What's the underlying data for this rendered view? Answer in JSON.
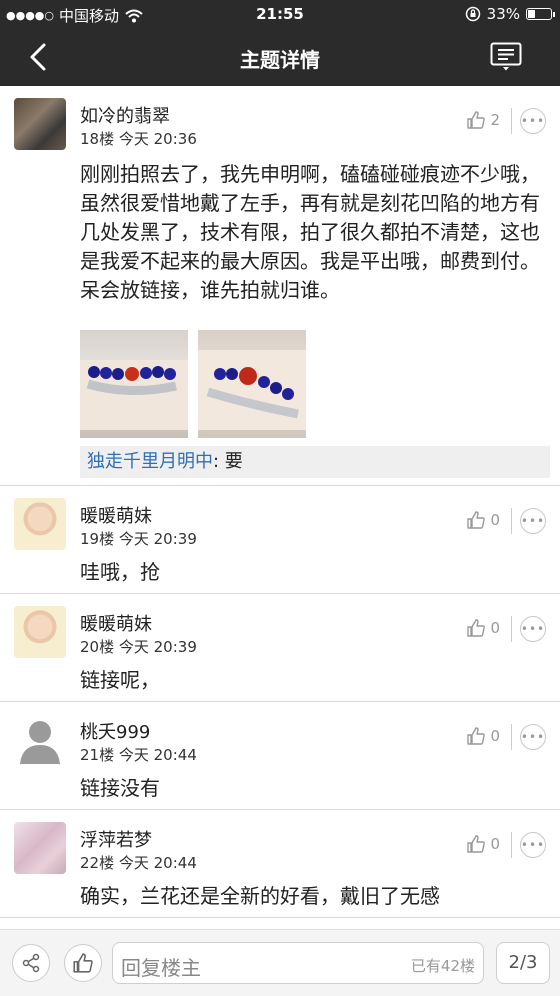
{
  "status_bar": {
    "carrier": "中国移动",
    "time": "21:55",
    "battery": "33%",
    "battery_level": 0.33
  },
  "nav": {
    "title": "主题详情"
  },
  "posts": [
    {
      "author": "如冷的翡翠",
      "floor": "18楼",
      "time": "今天 20:36",
      "likes": "2",
      "content": "刚刚拍照去了，我先申明啊，磕磕碰碰痕迹不少哦，虽然很爱惜地戴了左手，再有就是刻花凹陷的地方有几处发黑了，技术有限，拍了很久都拍不清楚，这也是我爱不起来的最大原因。我是平出哦，邮费到付。呆会放链接，谁先拍就归谁。",
      "reply_quote": {
        "author": "独走千里月明中",
        "text": ": 要"
      }
    },
    {
      "author": "暖暖萌妹",
      "floor": "19楼",
      "time": "今天 20:39",
      "likes": "0",
      "content": "哇哦，抢"
    },
    {
      "author": "暖暖萌妹",
      "floor": "20楼",
      "time": "今天 20:39",
      "likes": "0",
      "content": "链接呢，"
    },
    {
      "author": "桃夭999",
      "floor": "21楼",
      "time": "今天 20:44",
      "likes": "0",
      "content": "链接没有"
    },
    {
      "author": "浮萍若梦",
      "floor": "22楼",
      "time": "今天 20:44",
      "likes": "0",
      "content": "确实，兰花还是全新的好看，戴旧了无感"
    }
  ],
  "bottom_bar": {
    "reply_placeholder": "回复楼主",
    "reply_count": "已有42楼",
    "page": "2/3"
  }
}
